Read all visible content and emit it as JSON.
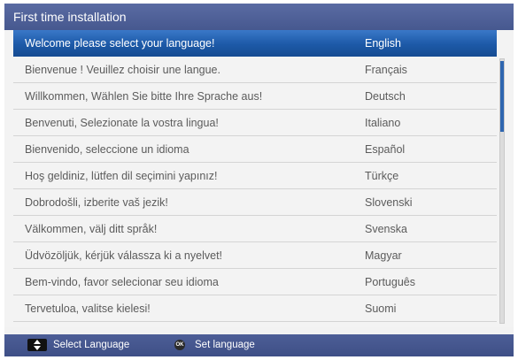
{
  "header": {
    "title": "First time installation"
  },
  "languages": [
    {
      "message": "Welcome please select your language!",
      "language": "English"
    },
    {
      "message": "Bienvenue ! Veuillez choisir une langue.",
      "language": "Français"
    },
    {
      "message": "Willkommen, Wählen Sie bitte Ihre Sprache aus!",
      "language": "Deutsch"
    },
    {
      "message": "Benvenuti, Selezionate la vostra lingua!",
      "language": "Italiano"
    },
    {
      "message": "Bienvenido, seleccione un idioma",
      "language": "Español"
    },
    {
      "message": "Hoş geldiniz, lütfen dil seçimini yapınız!",
      "language": "Türkçe"
    },
    {
      "message": "Dobrodošli, izberite vaš jezik!",
      "language": "Slovenski"
    },
    {
      "message": "Välkommen, välj ditt språk!",
      "language": "Svenska"
    },
    {
      "message": "Üdvözöljük, kérjük válassza ki a nyelvet!",
      "language": "Magyar"
    },
    {
      "message": "Bem-vindo, favor selecionar seu idioma",
      "language": "Português"
    },
    {
      "message": "Tervetuloa, valitse kielesi!",
      "language": "Suomi"
    }
  ],
  "selected_language": "English",
  "footer": {
    "hint_select": "Select Language",
    "hint_set": "Set language",
    "ok_key_label": "OK",
    "navigate_icon": "up-down-arrows-icon",
    "ok_icon": "ok-button-icon"
  },
  "colors": {
    "title_bar": "#4f619b",
    "selection": "#2566b4",
    "text": "#5b5b5b"
  }
}
